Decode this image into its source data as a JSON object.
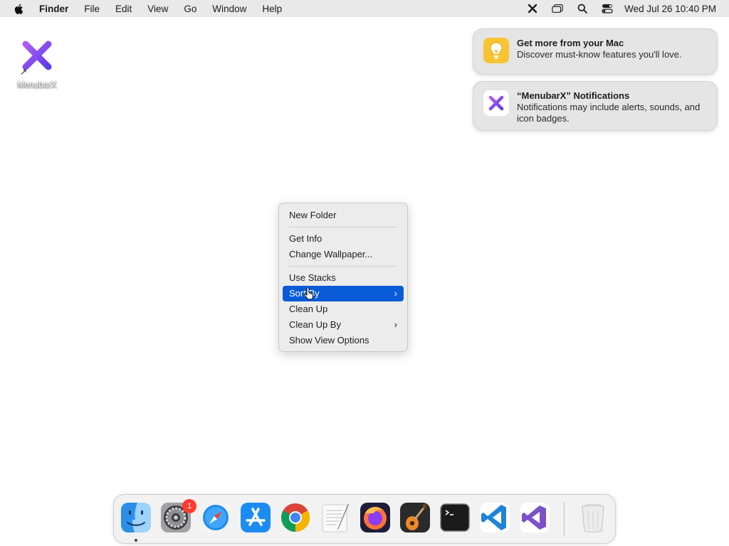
{
  "menubar": {
    "apple_icon": "apple-icon",
    "app_name": "Finder",
    "items": [
      "File",
      "Edit",
      "View",
      "Go",
      "Window",
      "Help"
    ],
    "status_icons": [
      "menubarx-icon",
      "window-stack-icon",
      "spotlight-search-icon",
      "control-center-icon"
    ],
    "clock": "Wed Jul 26  10:40 PM"
  },
  "desktop": {
    "icon_label": "MenubarX",
    "icon": "menubarx-app-icon",
    "alias_arrow": "↗"
  },
  "notifications": [
    {
      "icon": "lightbulb-tips-icon",
      "title": "Get more from your Mac",
      "body": "Discover must-know features you'll love."
    },
    {
      "icon": "menubarx-app-icon",
      "title": "“MenubarX” Notifications",
      "body": "Notifications may include alerts, sounds, and icon badges."
    }
  ],
  "context_menu": {
    "group1": [
      "New Folder"
    ],
    "group2": [
      "Get Info",
      "Change Wallpaper..."
    ],
    "group3": [
      {
        "label": "Use Stacks",
        "submenu": false,
        "selected": false
      },
      {
        "label": "Sort By",
        "submenu": true,
        "selected": true
      },
      {
        "label": "Clean Up",
        "submenu": false,
        "selected": false
      },
      {
        "label": "Clean Up By",
        "submenu": true,
        "selected": false
      },
      {
        "label": "Show View Options",
        "submenu": false,
        "selected": false
      }
    ],
    "chevron": "›"
  },
  "dock": {
    "apps": [
      "finder",
      "system-settings",
      "safari",
      "app-store",
      "chrome",
      "textedit",
      "firefox",
      "garageband",
      "terminal",
      "vscode",
      "visual-studio",
      "trash"
    ],
    "settings_badge": "1"
  },
  "colors": {
    "selection": "#0a5bd8",
    "menubarx_purple": "#8a4bf0",
    "badge_red": "#ff3b30"
  }
}
